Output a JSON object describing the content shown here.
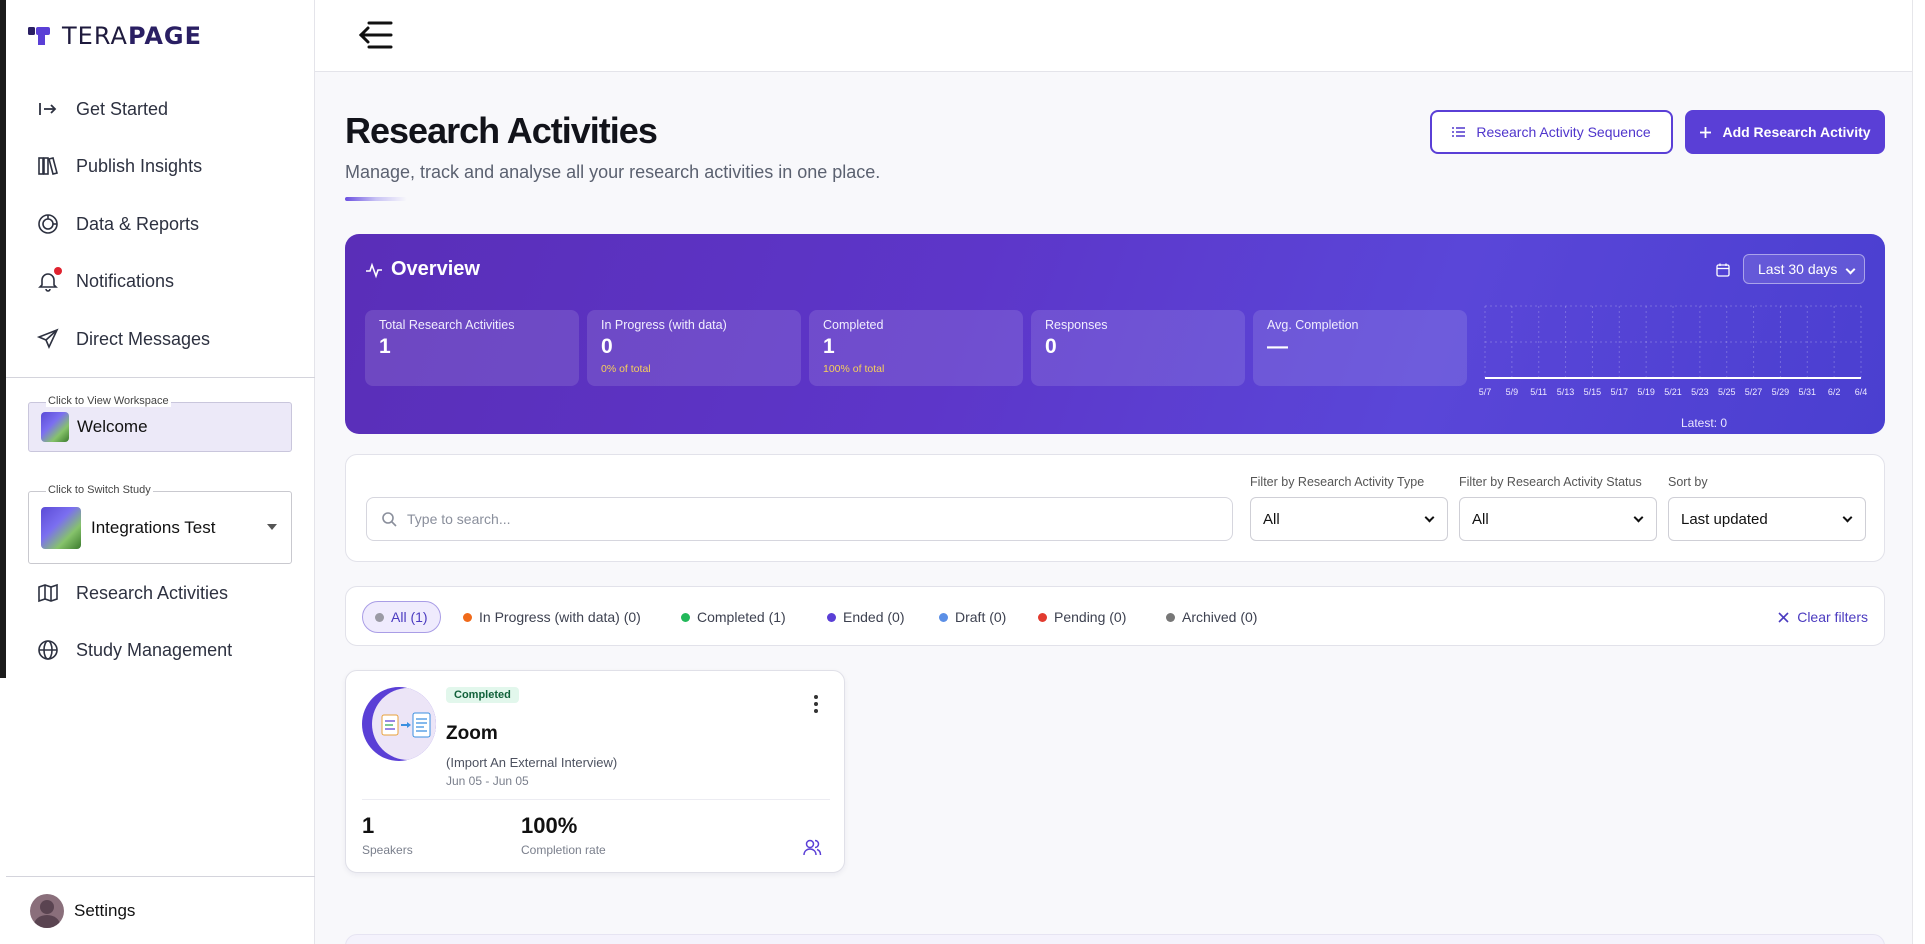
{
  "brand": {
    "logo_part1": "TERA",
    "logo_part2": "PAGE"
  },
  "colors": {
    "primary": "#5a3fd6",
    "overview_bg": "#5a36c8",
    "completed_badge": "#e2f7ec",
    "pct_text": "#f7cf5a"
  },
  "sidebar": {
    "nav": [
      {
        "label": "Get Started",
        "icon": "login-arrow-icon"
      },
      {
        "label": "Publish Insights",
        "icon": "books-icon"
      },
      {
        "label": "Data & Reports",
        "icon": "chart-pie-icon"
      },
      {
        "label": "Notifications",
        "icon": "bell-icon"
      },
      {
        "label": "Direct Messages",
        "icon": "send-icon"
      }
    ],
    "workspace": {
      "hint": "Click to View Workspace",
      "name": "Welcome"
    },
    "study": {
      "hint": "Click to Switch Study",
      "name": "Integrations Test"
    },
    "study_nav": [
      {
        "label": "Research Activities",
        "icon": "map-icon"
      },
      {
        "label": "Study Management",
        "icon": "globe-icon"
      }
    ],
    "settings_label": "Settings"
  },
  "header": {
    "title": "Research Activities",
    "subtitle": "Manage, track and analyse all your research activities in one place.",
    "sequence_button": "Research Activity Sequence",
    "add_button": "Add Research Activity"
  },
  "overview": {
    "title": "Overview",
    "range": "Last 30 days",
    "stats": [
      {
        "label": "Total Research Activities",
        "value": "1",
        "sub": ""
      },
      {
        "label": "In Progress (with data)",
        "value": "0",
        "sub": "0% of total"
      },
      {
        "label": "Completed",
        "value": "1",
        "sub": "100% of total"
      },
      {
        "label": "Responses",
        "value": "0",
        "sub": ""
      },
      {
        "label": "Avg. Completion",
        "value": "—",
        "sub": ""
      }
    ],
    "latest": "Latest: 0"
  },
  "chart_data": {
    "type": "line",
    "categories": [
      "5/7",
      "5/9",
      "5/11",
      "5/13",
      "5/15",
      "5/17",
      "5/19",
      "5/21",
      "5/23",
      "5/25",
      "5/27",
      "5/29",
      "5/31",
      "6/2",
      "6/4"
    ],
    "values": [
      0,
      0,
      0,
      0,
      0,
      0,
      0,
      0,
      0,
      0,
      0,
      0,
      0,
      0,
      0
    ],
    "grid": true
  },
  "filters": {
    "search_placeholder": "Type to search...",
    "type": {
      "label": "Filter by Research Activity Type",
      "value": "All"
    },
    "status": {
      "label": "Filter by Research Activity Status",
      "value": "All"
    },
    "sort": {
      "label": "Sort by",
      "value": "Last updated"
    }
  },
  "chips": [
    {
      "label": "All (1)",
      "color": "#9a9aa4"
    },
    {
      "label": "In Progress (with data) (0)",
      "color": "#f06a1a"
    },
    {
      "label": "Completed (1)",
      "color": "#22b85a"
    },
    {
      "label": "Ended (0)",
      "color": "#5a3fd6"
    },
    {
      "label": "Draft (0)",
      "color": "#5b8fe6"
    },
    {
      "label": "Pending (0)",
      "color": "#e23b2f"
    },
    {
      "label": "Archived (0)",
      "color": "#777777"
    }
  ],
  "clear_filters": "Clear filters",
  "activity": {
    "badge": "Completed",
    "name": "Zoom",
    "type": "(Import An External Interview)",
    "dates": "Jun 05 - Jun 05",
    "stat1": {
      "value": "1",
      "label": "Speakers"
    },
    "stat2": {
      "value": "100%",
      "label": "Completion rate"
    }
  }
}
